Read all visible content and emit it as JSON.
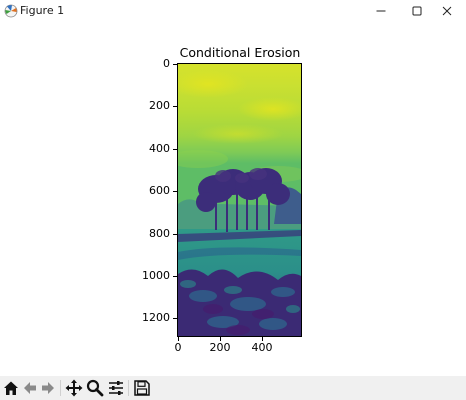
{
  "window": {
    "title": "Figure 1",
    "icon": "matplotlib-icon",
    "controls": [
      "minimize-icon",
      "maximize-icon",
      "close-icon"
    ]
  },
  "figure": {
    "plot_title": "Conditional Erosion",
    "image_description_colormap": "viridis",
    "y_ticks": [
      "0",
      "200",
      "400",
      "600",
      "800",
      "1000",
      "1200"
    ],
    "x_ticks": [
      "0",
      "200",
      "400"
    ]
  },
  "toolbar": {
    "buttons": [
      "home-icon",
      "back-icon",
      "forward-icon",
      "pan-icon",
      "zoom-icon",
      "configure-subplots-icon",
      "save-icon"
    ]
  },
  "colors": {
    "toolbar_bg": "#f0f0f0",
    "viridis_dark": "#3b2c78",
    "viridis_mid": "#2a8f8a",
    "viridis_green": "#7ccb57",
    "viridis_yellow": "#d4e02a"
  }
}
